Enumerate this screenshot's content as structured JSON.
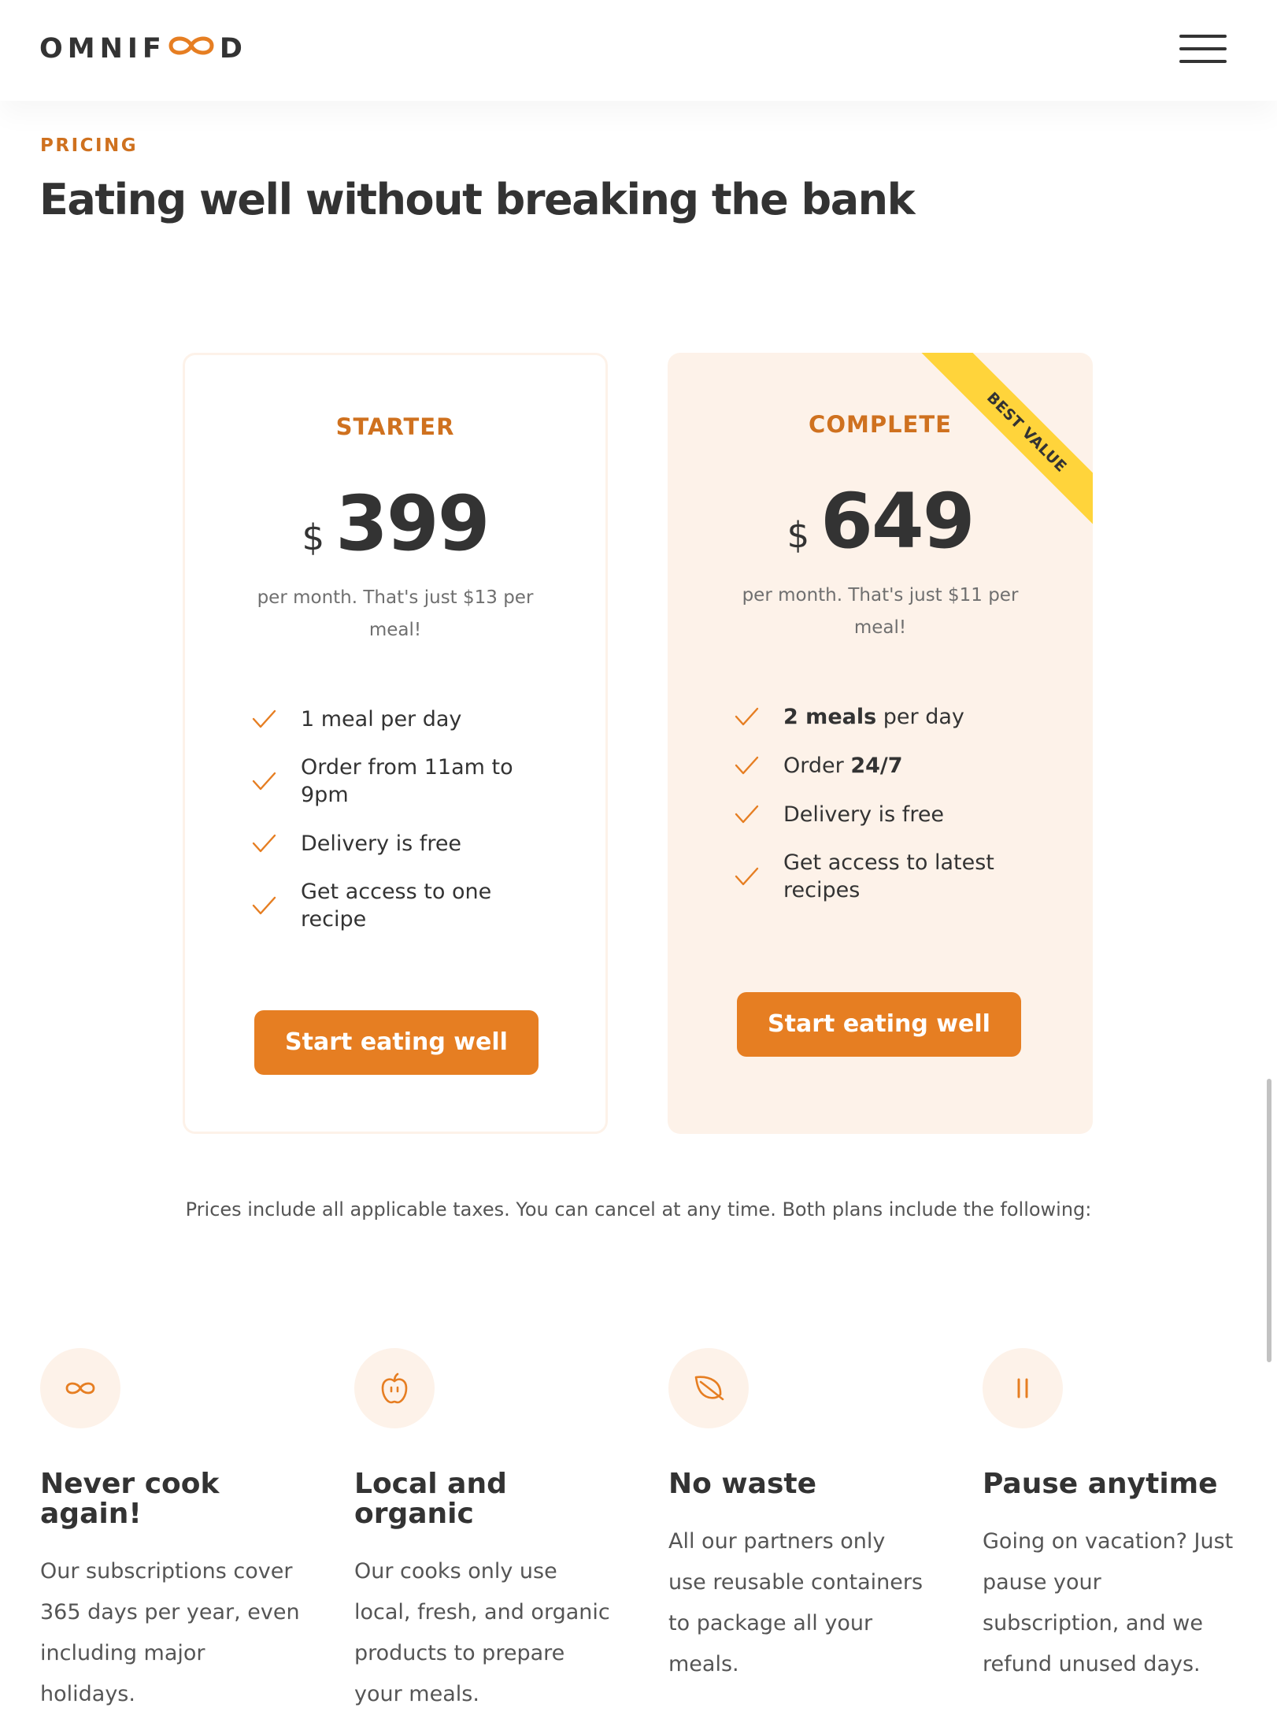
{
  "header": {
    "logo": {
      "before": "OMNIF",
      "after": "D"
    },
    "menu_icon": "hamburger-menu-icon"
  },
  "section": {
    "subheading": "PRICING",
    "title": "Eating well without breaking the bank"
  },
  "plans": [
    {
      "name": "STARTER",
      "currency": "$",
      "price": "399",
      "price_text": "per month. That's just $13 per meal!",
      "features": [
        {
          "bold_pre": "",
          "text": "1 meal per day",
          "bold_post": ""
        },
        {
          "bold_pre": "",
          "text": "Order from 11am to 9pm",
          "bold_post": ""
        },
        {
          "bold_pre": "",
          "text": "Delivery is free",
          "bold_post": ""
        },
        {
          "bold_pre": "",
          "text": "Get access to one recipe",
          "bold_post": ""
        }
      ],
      "button": "Start eating well"
    },
    {
      "name": "COMPLETE",
      "currency": "$",
      "price": "649",
      "price_text": "per month. That's just $11 per meal!",
      "features": [
        {
          "bold_pre": "2 meals",
          "text": " per day",
          "bold_post": ""
        },
        {
          "bold_pre": "",
          "text": "Order ",
          "bold_post": "24/7"
        },
        {
          "bold_pre": "",
          "text": "Delivery is free",
          "bold_post": ""
        },
        {
          "bold_pre": "",
          "text": "Get access to latest recipes",
          "bold_post": ""
        }
      ],
      "button": "Start eating well",
      "ribbon": "BEST VALUE"
    }
  ],
  "plan_details": "Prices include all applicable taxes. You can cancel at any time. Both plans include the following:",
  "features_grid": [
    {
      "icon": "infinity-icon",
      "title": "Never cook again!",
      "text": "Our subscriptions cover 365 days per year, even including major holidays."
    },
    {
      "icon": "apple-icon",
      "title": "Local and organic",
      "text": "Our cooks only use local, fresh, and organic products to prepare your meals."
    },
    {
      "icon": "leaf-icon",
      "title": "No waste",
      "text": "All our partners only use reusable containers to package all your meals."
    },
    {
      "icon": "pause-icon",
      "title": "Pause anytime",
      "text": "Going on vacation? Just pause your subscription, and we refund unused days."
    }
  ],
  "colors": {
    "primary": "#e67e22",
    "primary_dark": "#cf711f",
    "tint": "#fdf2e9",
    "ribbon": "#ffd43b",
    "text": "#333333"
  }
}
